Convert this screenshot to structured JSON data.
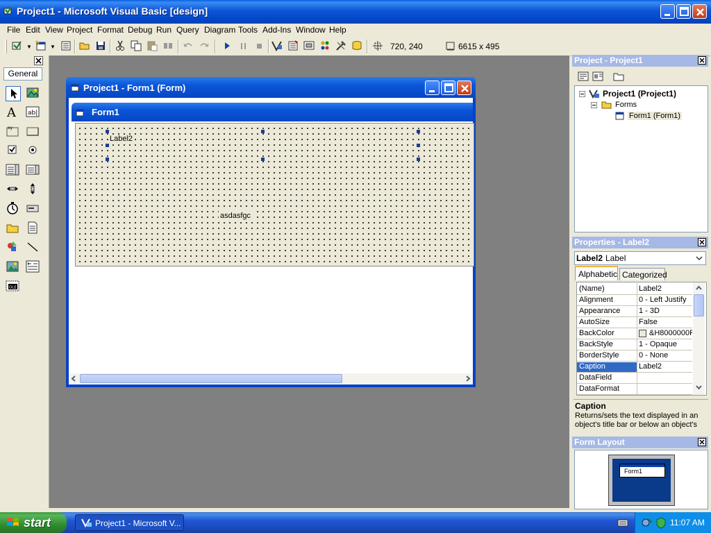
{
  "window": {
    "title": "Project1 - Microsoft Visual Basic [design]"
  },
  "menu": [
    "File",
    "Edit",
    "View",
    "Project",
    "Format",
    "Debug",
    "Run",
    "Query",
    "Diagram",
    "Tools",
    "Add-Ins",
    "Window",
    "Help"
  ],
  "toolbar": {
    "position": "720, 240",
    "size": "6615 x 495"
  },
  "toolbox": {
    "tab": "General"
  },
  "form_window": {
    "title": "Project1 - Form1 (Form)",
    "form_caption": "Form1",
    "label2_caption": "Label2",
    "text_box_text": "asdasfgc"
  },
  "project_panel": {
    "title": "Project - Project1",
    "tree": {
      "root": "Project1 (Project1)",
      "folder": "Forms",
      "item": "Form1 (Form1)"
    }
  },
  "properties_panel": {
    "title": "Properties - Label2",
    "object_name": "Label2",
    "object_type": "Label",
    "tabs": [
      "Alphabetic",
      "Categorized"
    ],
    "rows": [
      {
        "name": "(Name)",
        "value": "Label2"
      },
      {
        "name": "Alignment",
        "value": "0 - Left Justify"
      },
      {
        "name": "Appearance",
        "value": "1 - 3D"
      },
      {
        "name": "AutoSize",
        "value": "False"
      },
      {
        "name": "BackColor",
        "value": "&H8000000F"
      },
      {
        "name": "BackStyle",
        "value": "1 - Opaque"
      },
      {
        "name": "BorderStyle",
        "value": "0 - None"
      },
      {
        "name": "Caption",
        "value": "Label2"
      },
      {
        "name": "DataField",
        "value": ""
      },
      {
        "name": "DataFormat",
        "value": ""
      }
    ],
    "selected_row": "Caption",
    "desc_title": "Caption",
    "desc_text": "Returns/sets the text displayed in an object's title bar or below an object's"
  },
  "form_layout_panel": {
    "title": "Form Layout",
    "preview_label": "Form1"
  },
  "taskbar": {
    "start": "start",
    "task": "Project1 - Microsoft V...",
    "clock": "11:07 AM"
  },
  "colors": {
    "xp_blue": "#0a55d8",
    "selection": "#316ac5",
    "mdi_bg": "#808080"
  }
}
